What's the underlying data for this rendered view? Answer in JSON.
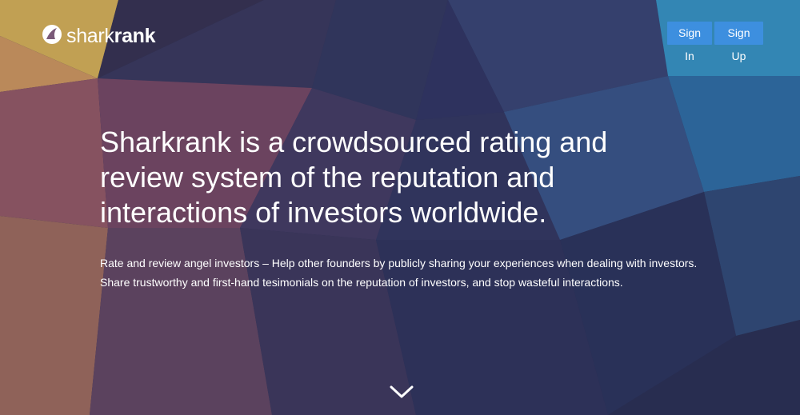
{
  "colors": {
    "button_bg": "#3d8fdf",
    "text": "#ffffff",
    "background_dark": "#2f3458",
    "accent_yellow": "#f0c858",
    "accent_teal": "#3aa3d6"
  },
  "header": {
    "logo": {
      "icon": "shark-fin-icon",
      "text_light": "shark",
      "text_bold": "rank"
    },
    "sign_in_label": "Sign In",
    "sign_up_label": "Sign Up"
  },
  "hero": {
    "headline": "Sharkrank is a crowdsourced rating and review system of the reputation and interactions of investors worldwide.",
    "lead": "Rate and review angel investors – Help other founders by publicly sharing your experiences when dealing with investors. Share trustworthy and first-hand tesimonials on the reputation of investors, and stop wasteful interactions.",
    "scroll_icon": "chevron-down-icon"
  }
}
